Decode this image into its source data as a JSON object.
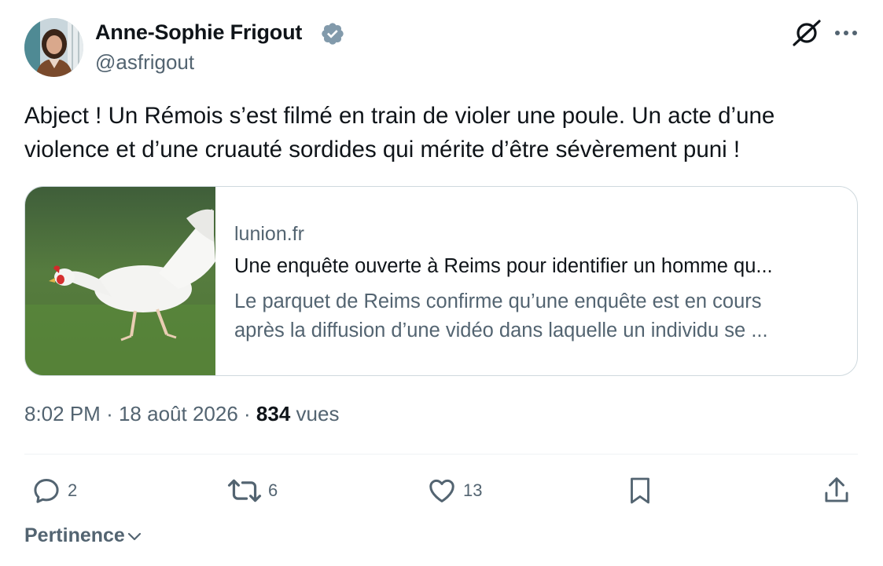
{
  "author": {
    "name": "Anne-Sophie Frigout",
    "handle": "@asfrigout",
    "verified": true
  },
  "header_actions": {
    "grok_icon": "grok-slash-icon",
    "more_icon": "more-horizontal-icon"
  },
  "tweet": {
    "text": "Abject ! Un Rémois s’est filmé en train de violer une poule. Un acte d’une violence et d’une cruauté sordides qui mérite d’être sévèrement puni !"
  },
  "link_card": {
    "domain": "lunion.fr",
    "title": "Une enquête ouverte à Reims pour identifier un homme qu...",
    "description_line1": "Le parquet de Reims confirme qu’une enquête est en cours",
    "description_line2": "après la diffusion d’une vidéo dans laquelle un individu se ...",
    "image": "white-hen-on-grass"
  },
  "meta": {
    "time": "8:02 PM",
    "date": "18 août 2026",
    "separator": "·",
    "views": "834",
    "views_label": "vues"
  },
  "actions": {
    "replies": "2",
    "reposts": "6",
    "likes": "13"
  },
  "replies_sort": {
    "label": "Pertinence"
  },
  "colors": {
    "text": "#0f1419",
    "secondary": "#536471",
    "border": "#cfd9de",
    "verified_badge": "#829aab"
  }
}
